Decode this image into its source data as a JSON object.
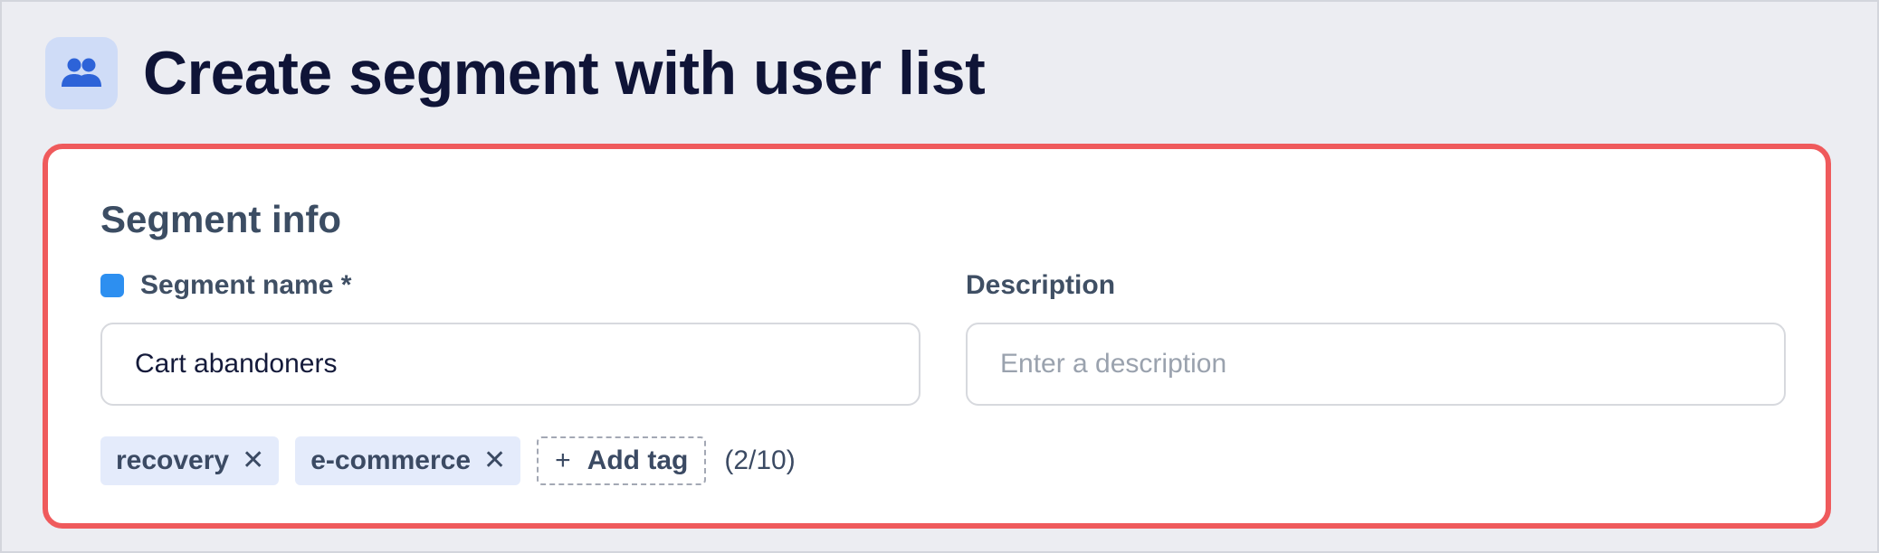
{
  "header": {
    "title": "Create segment with user list",
    "icon": "users-icon"
  },
  "card": {
    "section_title": "Segment info",
    "name_field": {
      "label": "Segment name *",
      "value": "Cart abandoners"
    },
    "description_field": {
      "label": "Description",
      "placeholder": "Enter a description",
      "value": ""
    },
    "tags": [
      {
        "label": "recovery",
        "remove_icon": "close-icon"
      },
      {
        "label": "e-commerce",
        "remove_icon": "close-icon"
      }
    ],
    "add_tag": {
      "symbol": "+",
      "label": "Add tag"
    },
    "tag_count": "(2/10)"
  },
  "colors": {
    "accent": "#2d8ff0",
    "highlight_border": "#ef5a5c",
    "tag_background": "#e4ebfb",
    "header_icon_background": "#cfdcf7",
    "header_icon_color": "#2d63d8"
  }
}
